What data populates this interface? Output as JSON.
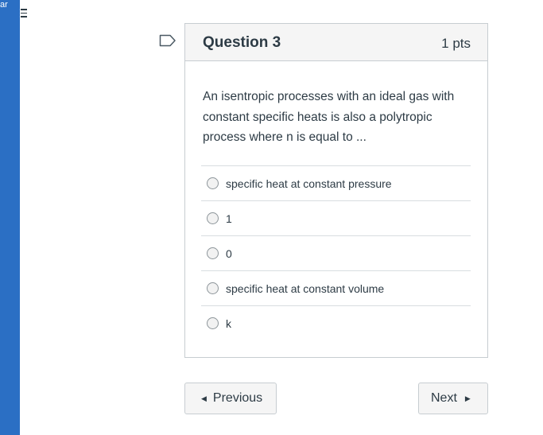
{
  "sidebar": {
    "partial_text": "ar"
  },
  "question": {
    "title": "Question 3",
    "points": "1 pts",
    "text": "An isentropic processes with an ideal gas with constant specific heats is also a polytropic process where n is equal to ...",
    "answers": [
      {
        "label": "specific heat at constant pressure"
      },
      {
        "label": "1"
      },
      {
        "label": "0"
      },
      {
        "label": "specific heat at constant volume"
      },
      {
        "label": "k"
      }
    ]
  },
  "nav": {
    "previous_label": "Previous",
    "next_label": "Next"
  },
  "icons": {
    "flag": "flag-icon",
    "menu": "hamburger-menu-icon",
    "prev": "caret-left-icon",
    "next": "caret-right-icon"
  },
  "colors": {
    "sidebar": "#2b6fc4",
    "text": "#2d3b45",
    "border": "#c7cdd1",
    "header_bg": "#f5f5f5"
  }
}
